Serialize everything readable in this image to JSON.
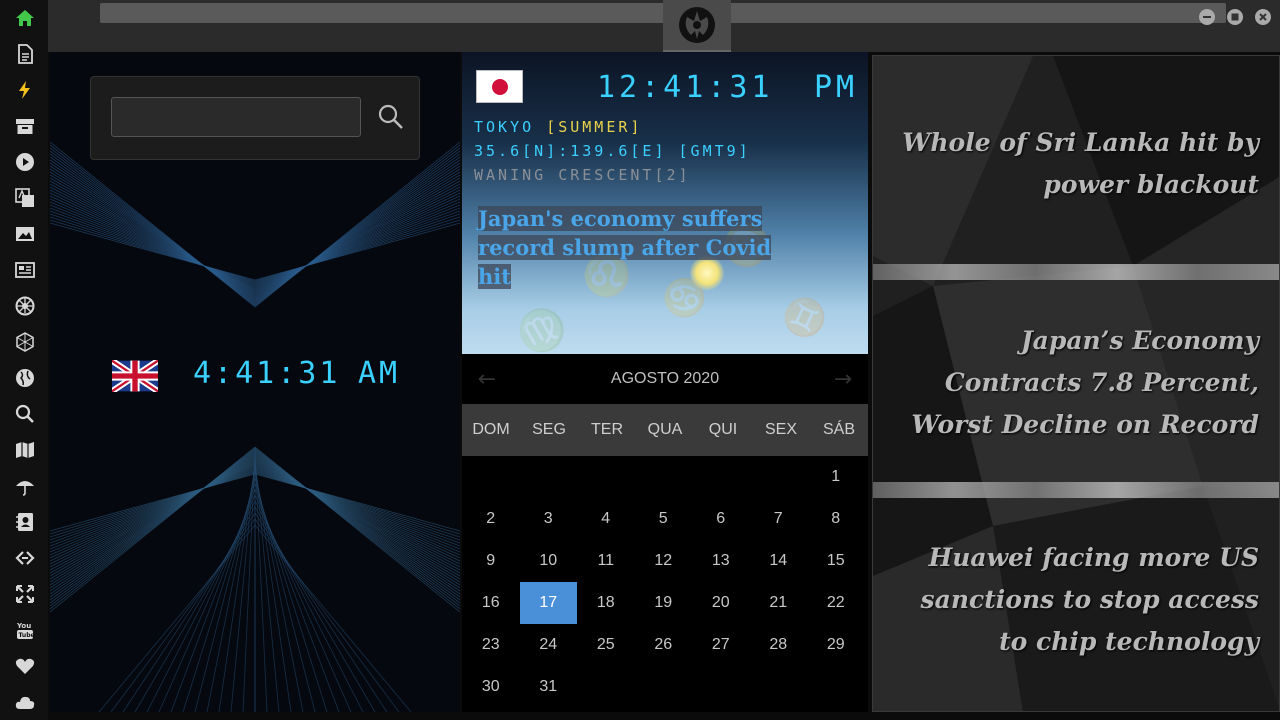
{
  "sidebar": {
    "items": [
      {
        "icon": "home-icon",
        "name": "sidebar-item-home"
      },
      {
        "icon": "document-icon",
        "name": "sidebar-item-documents"
      },
      {
        "icon": "lightning-icon",
        "name": "sidebar-item-flash"
      },
      {
        "icon": "archive-icon",
        "name": "sidebar-item-archive"
      },
      {
        "icon": "play-icon",
        "name": "sidebar-item-media"
      },
      {
        "icon": "translate-icon",
        "name": "sidebar-item-translate"
      },
      {
        "icon": "image-icon",
        "name": "sidebar-item-images"
      },
      {
        "icon": "newspaper-icon",
        "name": "sidebar-item-news"
      },
      {
        "icon": "empire-icon",
        "name": "sidebar-item-empire"
      },
      {
        "icon": "hexagon-icon",
        "name": "sidebar-item-network"
      },
      {
        "icon": "globe-icon",
        "name": "sidebar-item-world"
      },
      {
        "icon": "search-icon",
        "name": "sidebar-item-search"
      },
      {
        "icon": "map-icon",
        "name": "sidebar-item-map"
      },
      {
        "icon": "umbrella-icon",
        "name": "sidebar-item-weather"
      },
      {
        "icon": "contacts-icon",
        "name": "sidebar-item-contacts"
      },
      {
        "icon": "link-icon",
        "name": "sidebar-item-links"
      },
      {
        "icon": "expand-icon",
        "name": "sidebar-item-fullscreen"
      },
      {
        "icon": "youtube-icon",
        "name": "sidebar-item-youtube"
      },
      {
        "icon": "heart-icon",
        "name": "sidebar-item-favorites"
      },
      {
        "icon": "cloud-icon",
        "name": "sidebar-item-cloud"
      }
    ],
    "active_color": "#43c74a"
  },
  "search": {
    "value": "",
    "placeholder": ""
  },
  "london_clock": {
    "time": "4:41:31",
    "ampm": "AM"
  },
  "tokyo": {
    "time": "12:41:31",
    "ampm": "PM",
    "city": "TOKYO",
    "season": "[SUMMER]",
    "coords": "35.6[N]:139.6[E] [GMT9]",
    "moon": "WANING CRESCENT[2]",
    "headline": "Japan's economy suffers record slump after Covid hit"
  },
  "calendar": {
    "title": "AGOSTO 2020",
    "prev_arrow": "←",
    "next_arrow": "→",
    "weekdays": [
      "DOM",
      "SEG",
      "TER",
      "QUA",
      "QUI",
      "SEX",
      "SÁB"
    ],
    "weeks": [
      [
        "",
        "",
        "",
        "",
        "",
        "",
        "1"
      ],
      [
        "2",
        "3",
        "4",
        "5",
        "6",
        "7",
        "8"
      ],
      [
        "9",
        "10",
        "11",
        "12",
        "13",
        "14",
        "15"
      ],
      [
        "16",
        "17",
        "18",
        "19",
        "20",
        "21",
        "22"
      ],
      [
        "23",
        "24",
        "25",
        "26",
        "27",
        "28",
        "29"
      ],
      [
        "30",
        "31",
        "",
        "",
        "",
        "",
        ""
      ]
    ],
    "selected": "17",
    "selected_color": "#4a90d9"
  },
  "news": [
    "Whole of Sri Lanka hit by power blackout",
    "Japan’s Economy Contracts 7.8 Percent, Worst Decline on Record",
    "Huawei facing more US sanctions to stop access to chip technology"
  ],
  "colors": {
    "clock": "#3ad0ff",
    "season": "#e8d24a",
    "headline": "#4aa6e8"
  }
}
